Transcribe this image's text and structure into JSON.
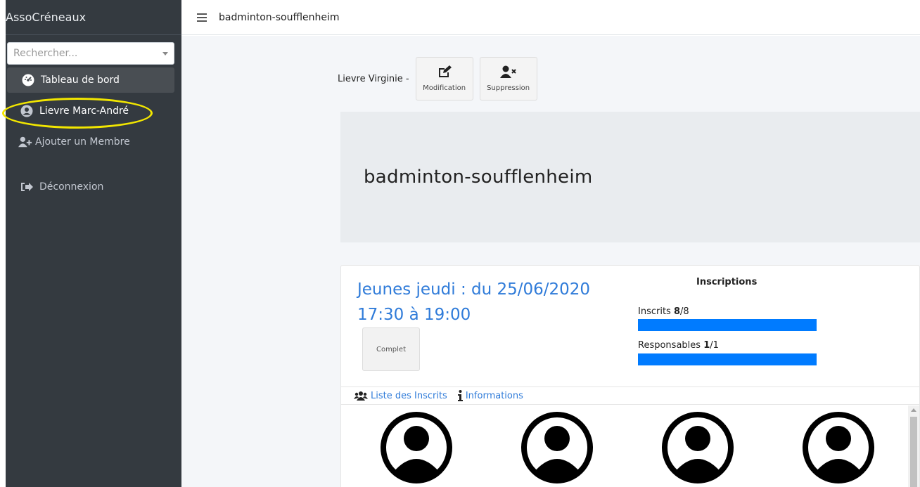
{
  "app": {
    "brand": "AssoCréneaux"
  },
  "search": {
    "placeholder": "Rechercher..."
  },
  "sidebar": {
    "items": [
      {
        "label": "Tableau de bord",
        "icon": "tachometer-icon"
      },
      {
        "label": "Lievre Marc-André",
        "icon": "user-circle-icon"
      },
      {
        "label": "Ajouter un Membre",
        "icon": "user-plus-icon"
      },
      {
        "label": "Déconnexion",
        "icon": "sign-out-icon"
      }
    ]
  },
  "topbar": {
    "title": "badminton-soufflenheim"
  },
  "userbar": {
    "name": "Lievre Virginie -",
    "modify_label": "Modification",
    "delete_label": "Suppression"
  },
  "jumbotron": {
    "title": "badminton-soufflenheim"
  },
  "slot": {
    "title": "Jeunes jeudi : du 25/06/2020 17:30 à 19:00",
    "status": "Complet",
    "inscriptions_title": "Inscriptions",
    "inscrits_label": "Inscrits",
    "inscrits_count": "8",
    "inscrits_total": "/8",
    "responsables_label": "Responsables",
    "responsables_count": "1",
    "responsables_total": "/1"
  },
  "tabs": [
    {
      "label": "Liste des Inscrits",
      "icon": "users-icon"
    },
    {
      "label": "Informations",
      "icon": "info-icon"
    }
  ],
  "colors": {
    "sidebar": "#343a40",
    "accent": "#007bff",
    "link": "#2f7bd9",
    "highlight": "#f2e600"
  }
}
